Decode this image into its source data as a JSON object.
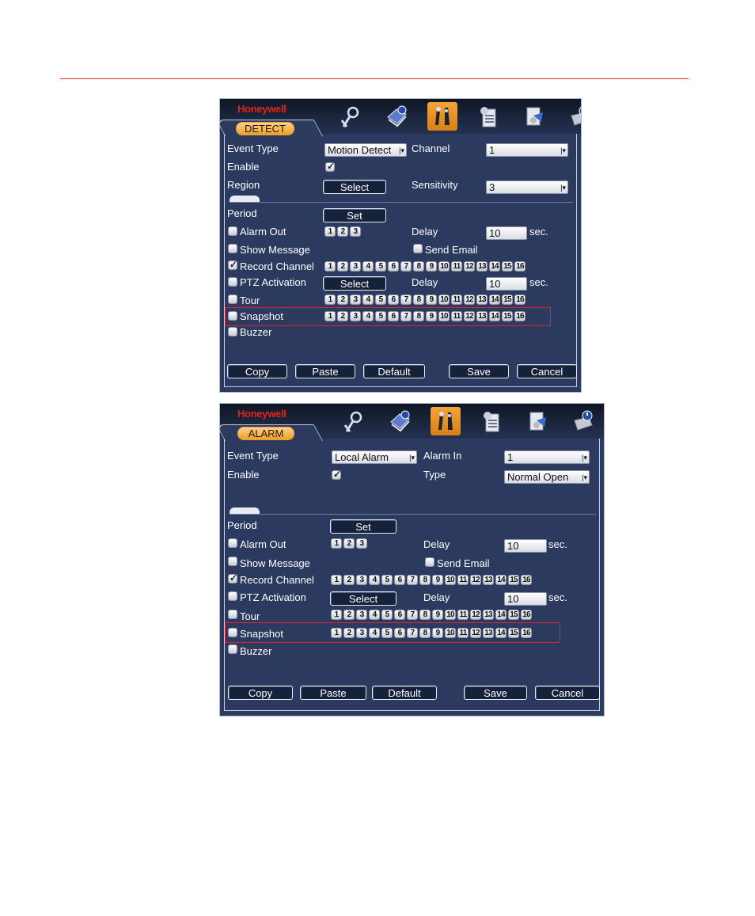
{
  "colors": {
    "rule": "#e0301e",
    "highlight": "#d7262e",
    "panel_bg": "#2b3a5e",
    "tab_orange": "#f0a020"
  },
  "panels": [
    {
      "brand": "Honeywell",
      "tab": "DETECT",
      "icons": [
        "search-person-icon",
        "book-info-icon",
        "tools-icon",
        "user-clipboard-icon",
        "document-settings-icon",
        "disk-power-icon"
      ],
      "active_icon": 2,
      "fields": {
        "event_type_label": "Event Type",
        "event_type_value": "Motion Detect",
        "right1_label": "Channel",
        "right1_value": "1",
        "enable_label": "Enable",
        "region_label": "Region",
        "region_button": "Select",
        "sensitivity_label": "Sensitivity",
        "sensitivity_value": "3"
      },
      "rows": {
        "period_label": "Period",
        "period_button": "Set",
        "alarm_out_label": "Alarm Out",
        "alarm_out_chips": [
          "1",
          "2",
          "3"
        ],
        "delay_label": "Delay",
        "delay_value": "10",
        "sec_label": "sec.",
        "show_message_label": "Show Message",
        "send_email_label": "Send Email",
        "record_channel_label": "Record Channel",
        "ptz_label": "PTZ Activation",
        "ptz_button": "Select",
        "delay2_label": "Delay",
        "delay2_value": "10",
        "sec2_label": "sec.",
        "tour_label": "Tour",
        "snapshot_label": "Snapshot",
        "buzzer_label": "Buzzer"
      },
      "channel_chips": [
        "1",
        "2",
        "3",
        "4",
        "5",
        "6",
        "7",
        "8",
        "9",
        "10",
        "11",
        "12",
        "13",
        "14",
        "15",
        "16"
      ],
      "buttons": {
        "copy": "Copy",
        "paste": "Paste",
        "default": "Default",
        "save": "Save",
        "cancel": "Cancel"
      }
    },
    {
      "brand": "Honeywell",
      "tab": "ALARM",
      "icons": [
        "search-person-icon",
        "book-info-icon",
        "tools-icon",
        "user-clipboard-icon",
        "document-settings-icon",
        "disk-power-icon"
      ],
      "active_icon": 2,
      "fields": {
        "event_type_label": "Event Type",
        "event_type_value": "Local Alarm",
        "right1_label": "Alarm In",
        "right1_value": "1",
        "enable_label": "Enable",
        "type_label": "Type",
        "type_value": "Normal Open"
      },
      "rows": {
        "period_label": "Period",
        "period_button": "Set",
        "alarm_out_label": "Alarm Out",
        "alarm_out_chips": [
          "1",
          "2",
          "3"
        ],
        "delay_label": "Delay",
        "delay_value": "10",
        "sec_label": "sec.",
        "show_message_label": "Show Message",
        "send_email_label": "Send Email",
        "record_channel_label": "Record Channel",
        "ptz_label": "PTZ Activation",
        "ptz_button": "Select",
        "delay2_label": "Delay",
        "delay2_value": "10",
        "sec2_label": "sec.",
        "tour_label": "Tour",
        "snapshot_label": "Snapshot",
        "buzzer_label": "Buzzer"
      },
      "channel_chips": [
        "1",
        "2",
        "3",
        "4",
        "5",
        "6",
        "7",
        "8",
        "9",
        "10",
        "11",
        "12",
        "13",
        "14",
        "15",
        "16"
      ],
      "buttons": {
        "copy": "Copy",
        "paste": "Paste",
        "default": "Default",
        "save": "Save",
        "cancel": "Cancel"
      }
    }
  ]
}
